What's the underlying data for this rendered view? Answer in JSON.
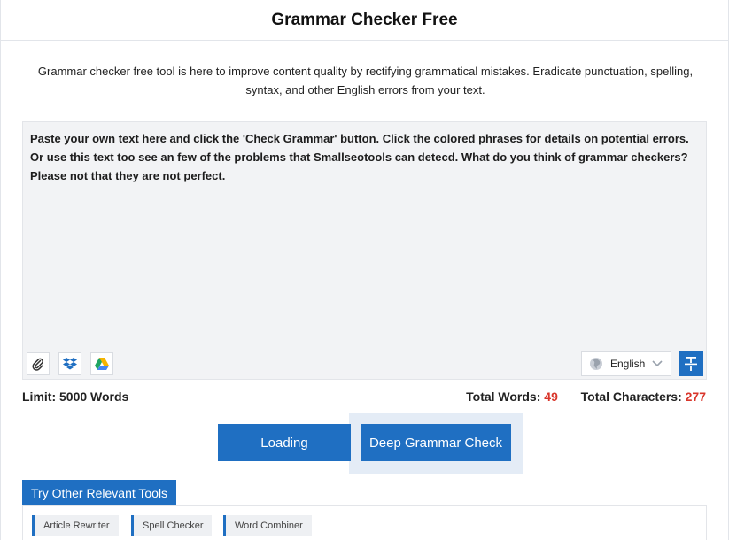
{
  "header": {
    "title": "Grammar Checker Free"
  },
  "description": "Grammar checker free tool is here to improve content quality by rectifying grammatical mistakes. Eradicate punctuation, spelling, syntax, and other English errors from your text.",
  "editor": {
    "text": "Paste your own text here and click the 'Check Grammar' button. Click the colored phrases for details on potential errors. Or use this text too see an few of the problems that Smallseotools can detecd. What do you think of grammar checkers? Please not that they are not perfect.",
    "icons": [
      "paperclip-icon",
      "dropbox-icon",
      "google-drive-icon",
      "globe-icon",
      "chevron-down-icon",
      "text-format-icon"
    ],
    "language": "English"
  },
  "stats": {
    "limit": "Limit: 5000 Words",
    "words_label": "Total Words:",
    "words_value": "49",
    "chars_label": "Total Characters:",
    "chars_value": "277"
  },
  "buttons": {
    "loading": "Loading",
    "deep_check": "Deep Grammar Check"
  },
  "tools": {
    "tab_label": "Try Other Relevant Tools",
    "items": [
      "Article Rewriter",
      "Spell Checker",
      "Word Combiner"
    ]
  },
  "colors": {
    "accent": "#1f6fc2",
    "count_red": "#d9362b",
    "editor_bg": "#f2f3f5"
  }
}
